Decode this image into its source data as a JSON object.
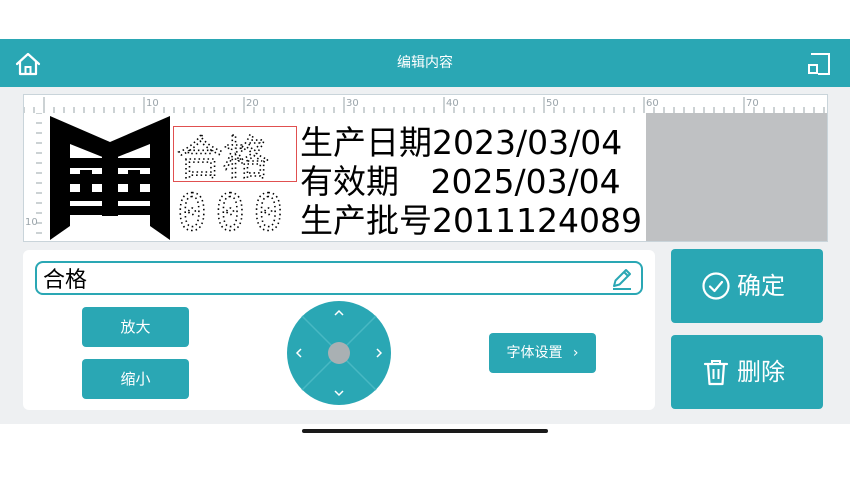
{
  "header": {
    "title": "编辑内容",
    "left_icon": "home-icon",
    "right_icon": "exit-icon"
  },
  "ruler": {
    "top_labels": [
      "10",
      "20",
      "30",
      "40",
      "50",
      "60",
      "70"
    ],
    "left_labels": [
      "10"
    ]
  },
  "print_preview": {
    "logo_icon": "label-logo-icon",
    "dot_text_top": "合格",
    "dot_text_bottom": "000",
    "lines": [
      "生产日期2023/03/04",
      "有效期   2025/03/04",
      "生产批号2011124089"
    ]
  },
  "editor": {
    "input_value": "合格",
    "edit_icon": "pencil-icon"
  },
  "controls": {
    "enlarge_label": "放大",
    "shrink_label": "缩小",
    "font_settings_label": "字体设置",
    "font_settings_icon": "chevron-right-icon"
  },
  "actions": {
    "confirm_label": "确定",
    "confirm_icon": "check-circle-icon",
    "delete_label": "删除",
    "delete_icon": "trash-icon"
  },
  "colors": {
    "accent": "#2aa7b4",
    "selection": "#e05050",
    "unprintable_area": "#bfc1c3"
  }
}
